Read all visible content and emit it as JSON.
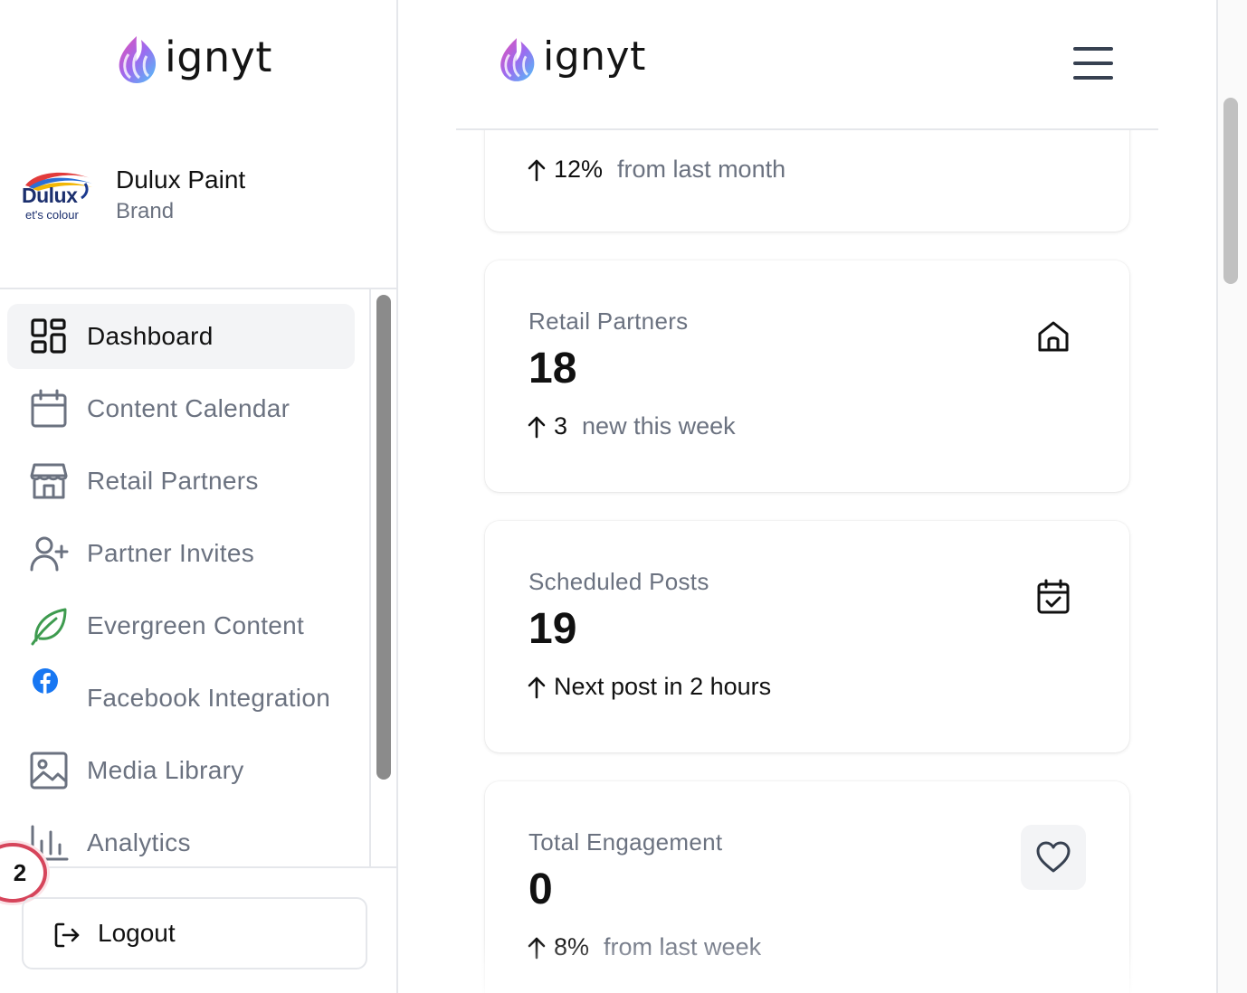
{
  "app": {
    "logo_text": "ignyt"
  },
  "brand": {
    "name": "Dulux Paint",
    "type": "Brand",
    "logo_word": "Dulux",
    "logo_tagline": "et's colour"
  },
  "sidebar": {
    "items": [
      {
        "label": "Dashboard",
        "icon": "dashboard-grid-icon",
        "active": true
      },
      {
        "label": "Content Calendar",
        "icon": "calendar-icon",
        "active": false
      },
      {
        "label": "Retail Partners",
        "icon": "storefront-icon",
        "active": false
      },
      {
        "label": "Partner Invites",
        "icon": "user-plus-icon",
        "active": false
      },
      {
        "label": "Evergreen Content",
        "icon": "leaf-icon",
        "active": false
      },
      {
        "label": "Facebook Integration",
        "icon": "facebook-icon",
        "active": false
      },
      {
        "label": "Media Library",
        "icon": "image-icon",
        "active": false
      },
      {
        "label": "Analytics",
        "icon": "bar-chart-icon",
        "active": false
      }
    ],
    "notification_count": "2",
    "logout_label": "Logout"
  },
  "main": {
    "cards": [
      {
        "title": "",
        "value": "",
        "trend_value": "12%",
        "trend_note": "from last month"
      },
      {
        "title": "Retail Partners",
        "value": "18",
        "trend_value": "3",
        "trend_note": "new this week",
        "icon": "home-icon"
      },
      {
        "title": "Scheduled Posts",
        "value": "19",
        "trend_value": "Next post in 2 hours",
        "trend_note": "",
        "icon": "calendar-check-icon"
      },
      {
        "title": "Total Engagement",
        "value": "0",
        "trend_value": "8%",
        "trend_note": "from last week",
        "icon": "heart-icon"
      }
    ]
  },
  "colors": {
    "leaf_green": "#3e9b4f",
    "facebook_blue": "#1877f2",
    "badge_red": "#d6455b",
    "muted_text": "#6b7280",
    "logo_gradient": [
      "#e64fb3",
      "#9b6bf0",
      "#4fc3f7"
    ]
  }
}
